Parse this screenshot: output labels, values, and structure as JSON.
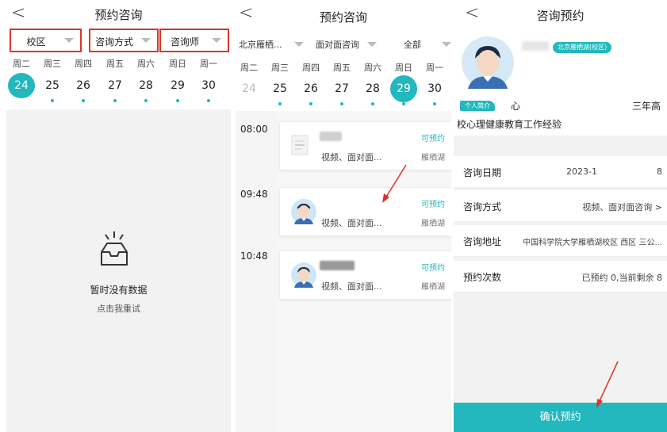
{
  "p1": {
    "back": "<",
    "title": "预约咨询",
    "filters": [
      "校区",
      "咨询方式",
      "咨询师"
    ],
    "weekdays": [
      "周二",
      "周三",
      "周四",
      "周五",
      "周六",
      "周日",
      "周一"
    ],
    "dates": [
      "24",
      "25",
      "26",
      "27",
      "28",
      "29",
      "30"
    ],
    "selected_date": "24",
    "empty_title": "暂时没有数据",
    "empty_retry": "点击我重试"
  },
  "p2": {
    "back": "<",
    "title": "预约咨询",
    "filters": [
      "北京雁栖...",
      "面对面咨询",
      "全部"
    ],
    "weekdays": [
      "周二",
      "周三",
      "周四",
      "周五",
      "周六",
      "周日",
      "周一"
    ],
    "dates": [
      "24",
      "25",
      "26",
      "27",
      "28",
      "29",
      "30"
    ],
    "selected_date": "29",
    "slots": [
      {
        "time": "08:00",
        "mode": "视频、面对面...",
        "status": "可预约",
        "location": "雁栖湖"
      },
      {
        "time": "09:48",
        "mode": "视频、面对面...",
        "status": "可预约",
        "location": "雁栖湖"
      },
      {
        "time": "10:48",
        "mode": "视频、面对面...",
        "status": "可预约",
        "location": "雁栖湖"
      }
    ]
  },
  "p3": {
    "back": "<",
    "title": "咨询预约",
    "campus_badge": "北京雁栖湖(校区)",
    "intro_tag": "个人简介",
    "intro_char": "心",
    "intro_right": "三年高",
    "intro_line": "校心理健康教育工作经验",
    "rows": [
      {
        "label": "咨询日期",
        "value": "2023-1",
        "value2": "8"
      },
      {
        "label": "咨询方式",
        "value": "视频、面对面咨询 >"
      },
      {
        "label": "咨询地址",
        "value": "中国科学院大学雁栖湖校区 西区 三公..."
      },
      {
        "label": "预约次数",
        "value": "已预约 0,当前剩余 8"
      }
    ],
    "confirm": "确认预约"
  },
  "colors": {
    "accent": "#22b8bd",
    "highlight_border": "#d9352b",
    "arrow": "#d9352b"
  }
}
